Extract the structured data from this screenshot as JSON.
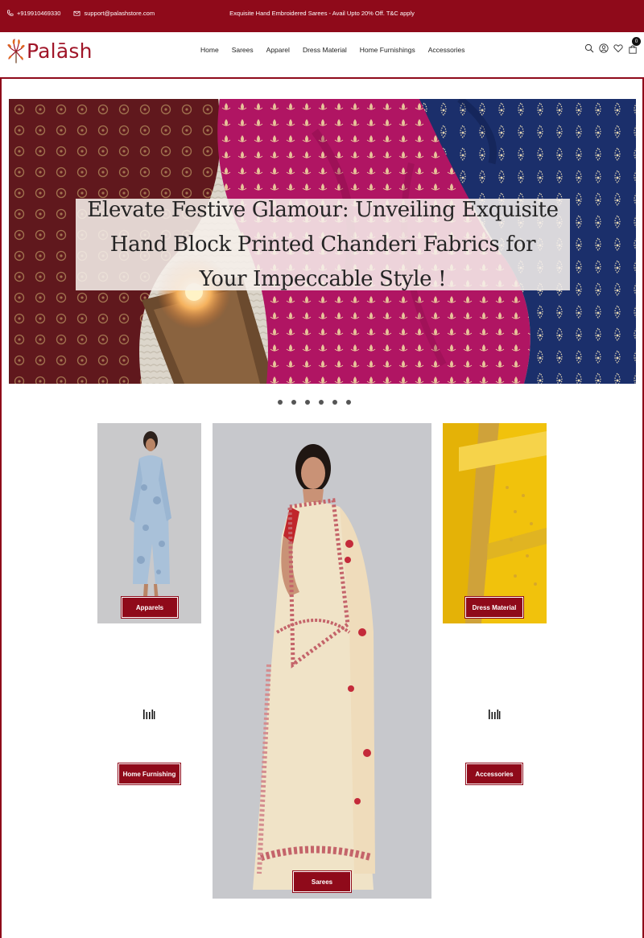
{
  "topbar": {
    "phone": "+919910469330",
    "email": "support@palashstore.com",
    "promo": "Exquisite Hand Embroidered Sarees - Avail Upto 20% Off. T&C apply"
  },
  "brand": {
    "name": "Palāsh"
  },
  "nav": [
    "Home",
    "Sarees",
    "Apparel",
    "Dress Material",
    "Home Furnishings",
    "Accessories"
  ],
  "cart": {
    "count": "0"
  },
  "hero": {
    "caption": "Elevate Festive Glamour: Unveiling Exquisite Hand Block Printed Chanderi Fabrics for Your Impeccable Style !",
    "slide_count": 6
  },
  "categories": {
    "apparels": "Apparels",
    "dress_material": "Dress Material",
    "home_furnishing": "Home Furnishing",
    "accessories": "Accessories",
    "sarees": "Sarees"
  },
  "colors": {
    "brand": "#8f0a1a",
    "maroon_fabric": "#6e1c22",
    "magenta_fabric": "#b01563",
    "navy_fabric": "#1b2f6b",
    "yellow_fabric": "#f1c20c"
  }
}
